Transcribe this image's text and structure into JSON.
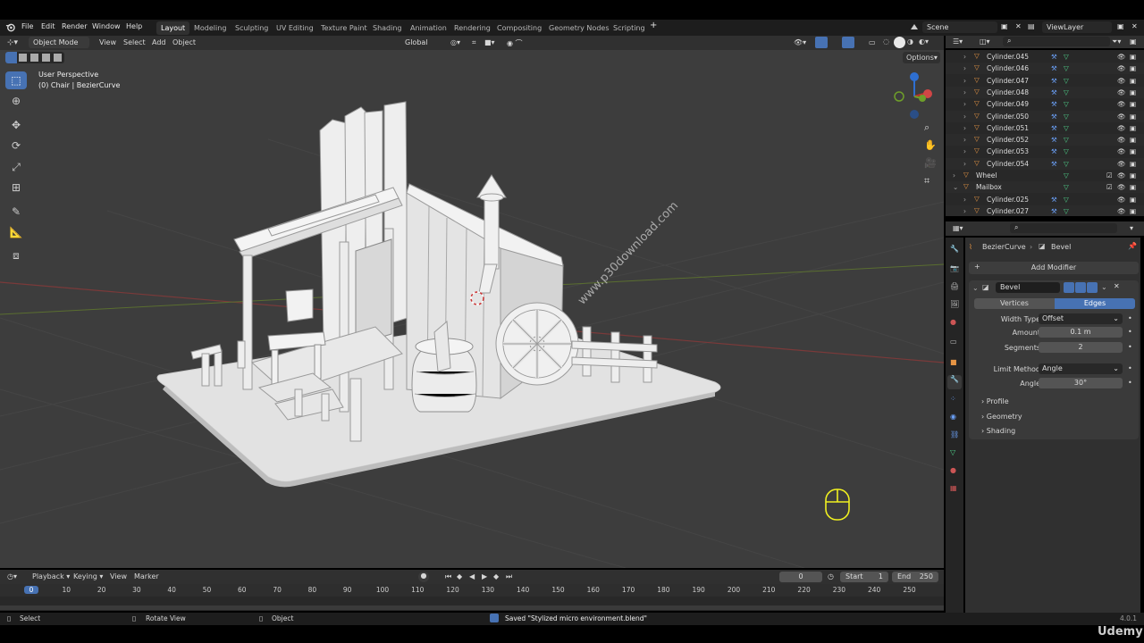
{
  "menu": [
    "File",
    "Edit",
    "Render",
    "Window",
    "Help"
  ],
  "workspaces": [
    "Layout",
    "Modeling",
    "Sculpting",
    "UV Editing",
    "Texture Paint",
    "Shading",
    "Animation",
    "Rendering",
    "Compositing",
    "Geometry Nodes",
    "Scripting"
  ],
  "active_workspace": "Layout",
  "scene": "Scene",
  "view_layer": "ViewLayer",
  "viewport": {
    "mode": "Object Mode",
    "menus": [
      "View",
      "Select",
      "Add",
      "Object"
    ],
    "transform_orientation": "Global",
    "options_label": "Options",
    "perspective_label": "User Perspective",
    "active_object_label": "(0) Chair | BezierCurve",
    "watermark": "www.p30download.com"
  },
  "outliner": {
    "rows": [
      {
        "name": "Cylinder.045",
        "indent": 2
      },
      {
        "name": "Cylinder.046",
        "indent": 2
      },
      {
        "name": "Cylinder.047",
        "indent": 2
      },
      {
        "name": "Cylinder.048",
        "indent": 2
      },
      {
        "name": "Cylinder.049",
        "indent": 2
      },
      {
        "name": "Cylinder.050",
        "indent": 2
      },
      {
        "name": "Cylinder.051",
        "indent": 2
      },
      {
        "name": "Cylinder.052",
        "indent": 2
      },
      {
        "name": "Cylinder.053",
        "indent": 2
      },
      {
        "name": "Cylinder.054",
        "indent": 2
      },
      {
        "name": "Wheel",
        "indent": 1
      },
      {
        "name": "Mailbox",
        "indent": 1
      },
      {
        "name": "Cylinder.025",
        "indent": 2
      },
      {
        "name": "Cylinder.027",
        "indent": 2
      }
    ]
  },
  "properties": {
    "breadcrumb_object": "BezierCurve",
    "breadcrumb_modifier": "Bevel",
    "add_modifier_label": "Add Modifier",
    "modifier_name": "Bevel",
    "affect_tabs": [
      "Vertices",
      "Edges"
    ],
    "active_affect": "Edges",
    "width_type_label": "Width Type",
    "width_type_value": "Offset",
    "amount_label": "Amount",
    "amount_value": "0.1 m",
    "segments_label": "Segments",
    "segments_value": "2",
    "limit_method_label": "Limit Method",
    "limit_method_value": "Angle",
    "angle_label": "Angle",
    "angle_value": "30°",
    "subpanels": [
      "Profile",
      "Geometry",
      "Shading"
    ]
  },
  "timeline": {
    "menus": [
      "Playback",
      "Keying",
      "View",
      "Marker"
    ],
    "current_frame": "0",
    "start_label": "Start",
    "start_value": "1",
    "end_label": "End",
    "end_value": "250",
    "ruler": [
      "0",
      "10",
      "20",
      "30",
      "40",
      "50",
      "60",
      "70",
      "80",
      "90",
      "100",
      "110",
      "120",
      "130",
      "140",
      "150",
      "160",
      "170",
      "180",
      "190",
      "200",
      "210",
      "220",
      "230",
      "240",
      "250"
    ]
  },
  "status": {
    "select": "Select",
    "rotate_view": "Rotate View",
    "object": "Object",
    "message": "Saved \"Stylized micro environment.blend\"",
    "version": "4.0.1"
  },
  "branding": "Udemy",
  "colors": {
    "accent": "#4772b3",
    "viewport_bg": "#3d3d3d",
    "mesh_icon": "#e59444",
    "modifier_icon": "#6a9ff5",
    "data_icon": "#4fd18a"
  }
}
